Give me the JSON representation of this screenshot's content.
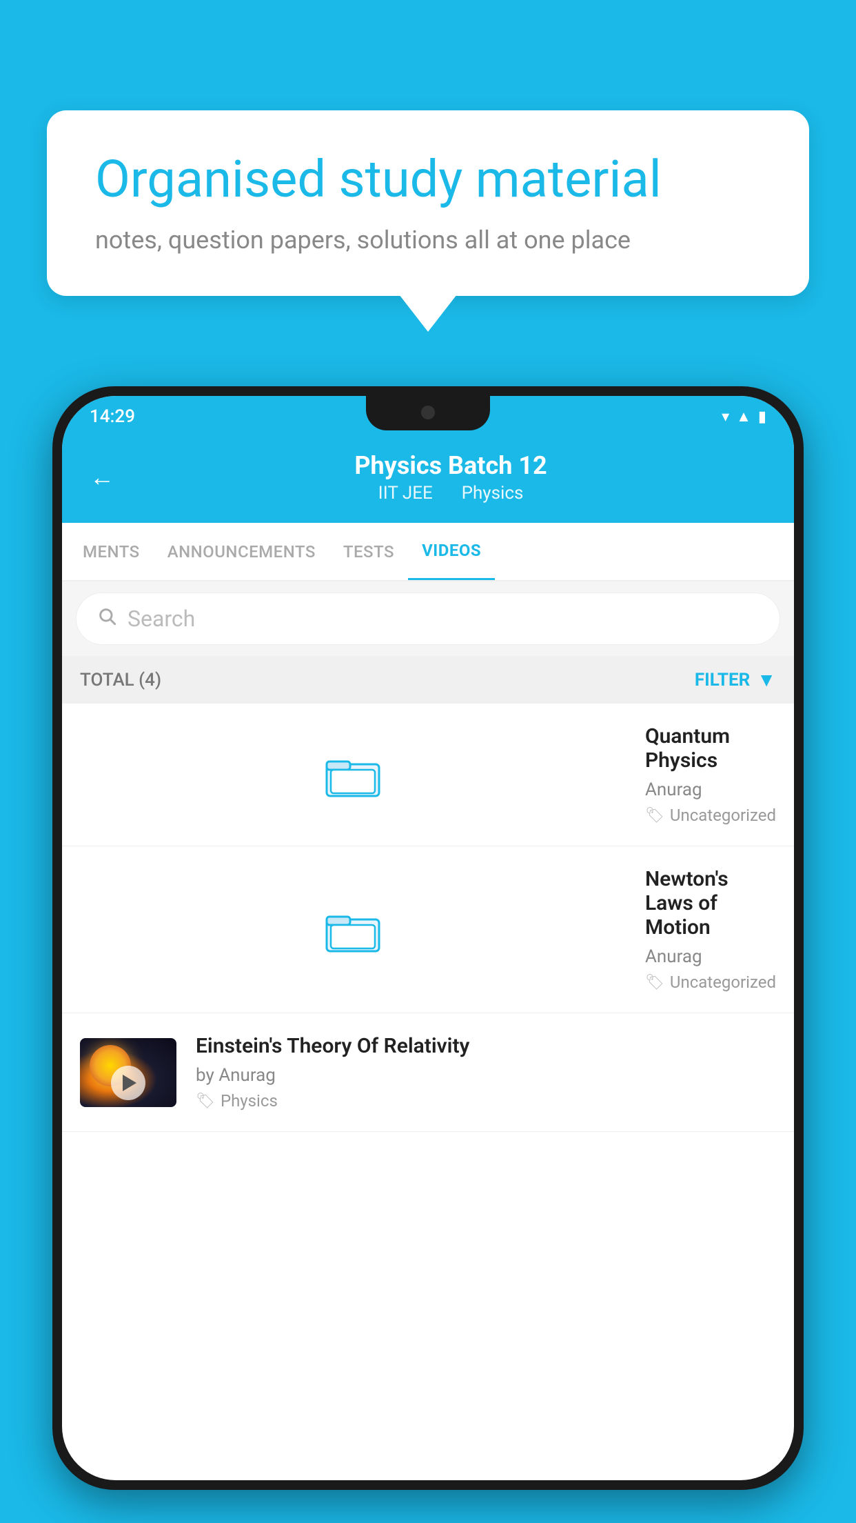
{
  "background_color": "#1ab9e8",
  "bubble": {
    "title": "Organised study material",
    "subtitle": "notes, question papers, solutions all at one place"
  },
  "phone": {
    "status_bar": {
      "time": "14:29",
      "icons": [
        "wifi",
        "signal",
        "battery"
      ]
    },
    "header": {
      "back_label": "←",
      "title": "Physics Batch 12",
      "subtitle_iit": "IIT JEE",
      "subtitle_physics": "Physics"
    },
    "tabs": [
      {
        "label": "MENTS",
        "active": false
      },
      {
        "label": "ANNOUNCEMENTS",
        "active": false
      },
      {
        "label": "TESTS",
        "active": false
      },
      {
        "label": "VIDEOS",
        "active": true
      }
    ],
    "search": {
      "placeholder": "Search"
    },
    "filter_bar": {
      "total_label": "TOTAL (4)",
      "filter_label": "FILTER"
    },
    "videos": [
      {
        "id": 1,
        "title": "Quantum Physics",
        "author": "Anurag",
        "tag": "Uncategorized",
        "has_thumbnail": false
      },
      {
        "id": 2,
        "title": "Newton's Laws of Motion",
        "author": "Anurag",
        "tag": "Uncategorized",
        "has_thumbnail": false
      },
      {
        "id": 3,
        "title": "Einstein's Theory Of Relativity",
        "author": "by Anurag",
        "tag": "Physics",
        "has_thumbnail": true
      }
    ]
  }
}
